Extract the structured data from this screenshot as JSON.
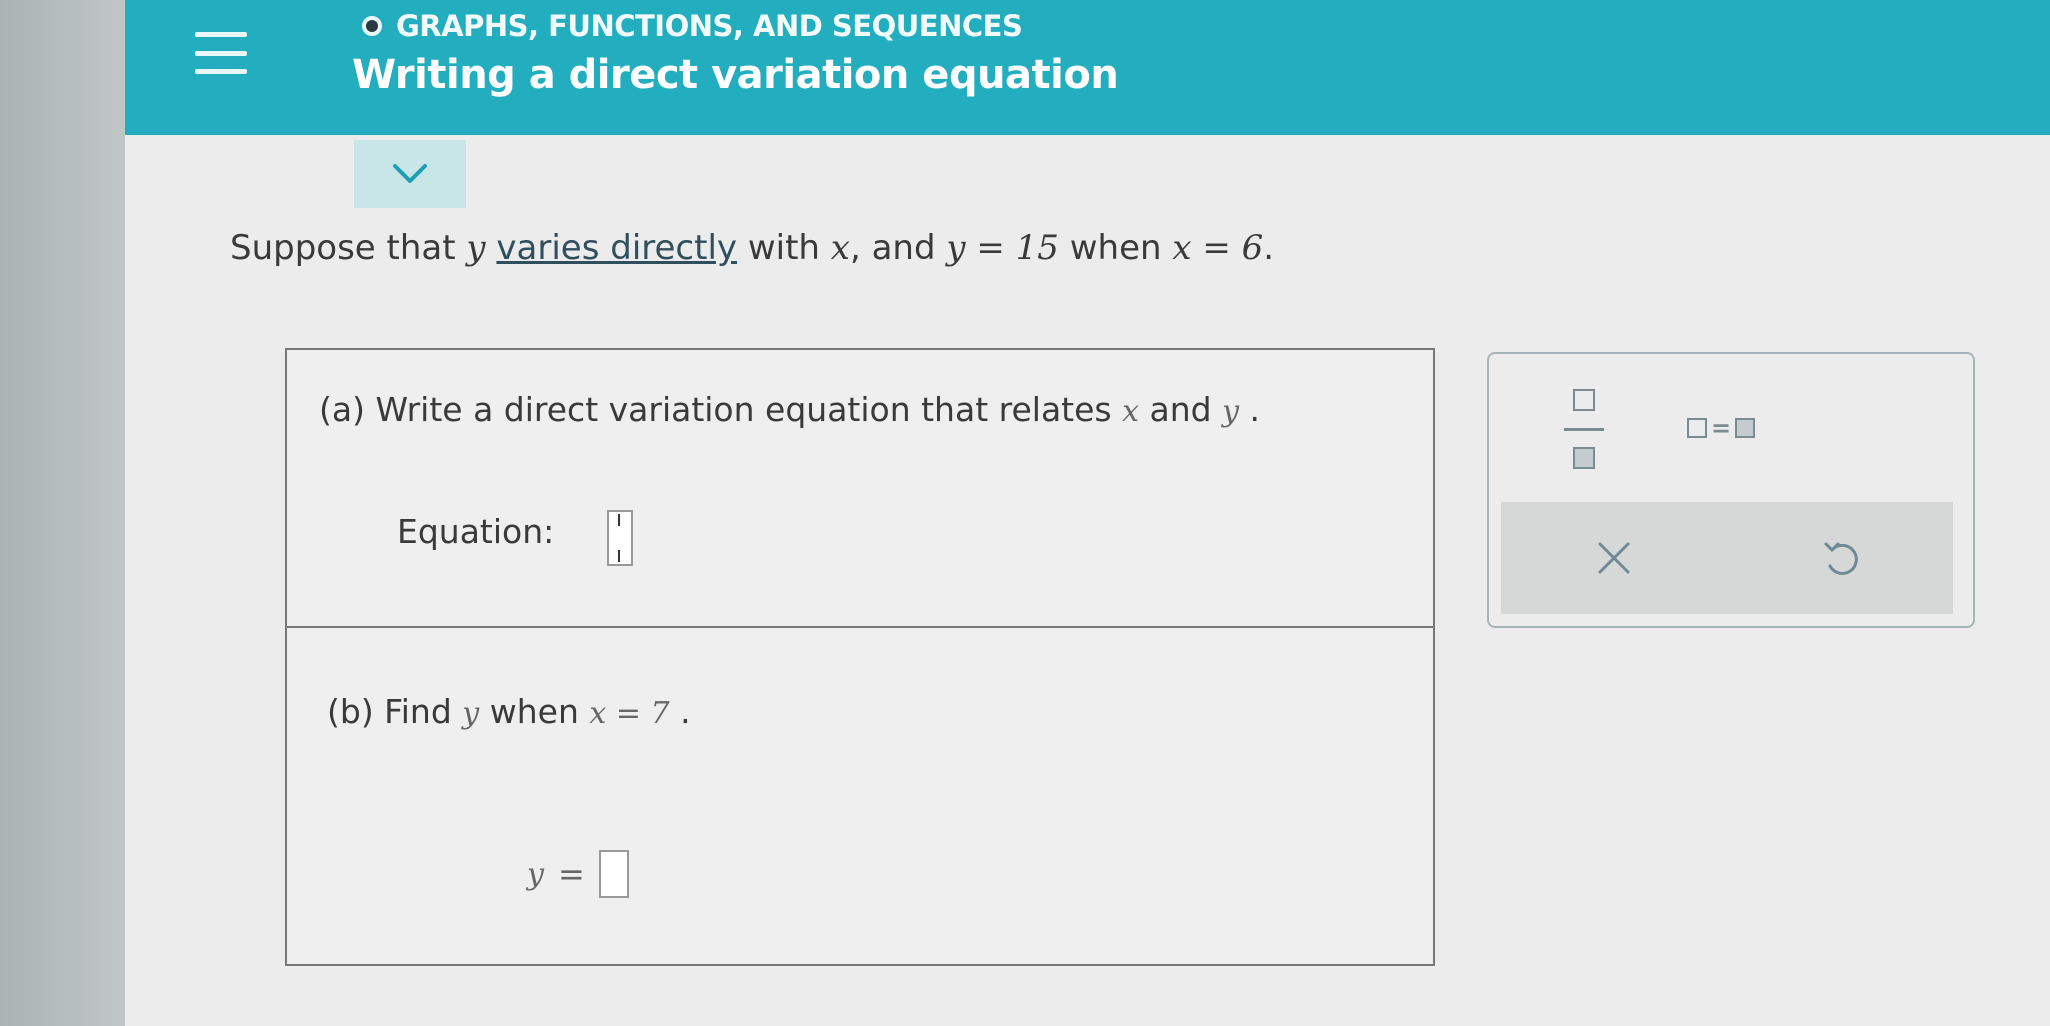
{
  "header": {
    "topic": "GRAPHS, FUNCTIONS, AND SEQUENCES",
    "lesson_title": "Writing a direct variation equation"
  },
  "question": {
    "pre": "Suppose that ",
    "var_y": "y",
    "link_text": "varies directly",
    "mid1": " with ",
    "var_x": "x",
    "mid2": ", and ",
    "cond_y": "y = 15",
    "mid3": " when ",
    "cond_x": "x = 6",
    "end": "."
  },
  "part_a": {
    "prompt_pre": "(a) Write a direct variation equation that relates ",
    "var_x": "x",
    "and": " and ",
    "var_y": "y",
    "end": " .",
    "equation_label": "Equation:"
  },
  "part_b": {
    "prompt_pre": "(b) Find ",
    "var_y": "y",
    "when": " when ",
    "cond": "x = 7",
    "end": " .",
    "answer_var": "y",
    "answer_eq": "="
  },
  "palette": {
    "equals_symbol": "=",
    "icons": [
      "fraction-icon",
      "equals-template-icon",
      "clear-x-icon",
      "undo-icon"
    ],
    "accent": "#22aebf"
  }
}
